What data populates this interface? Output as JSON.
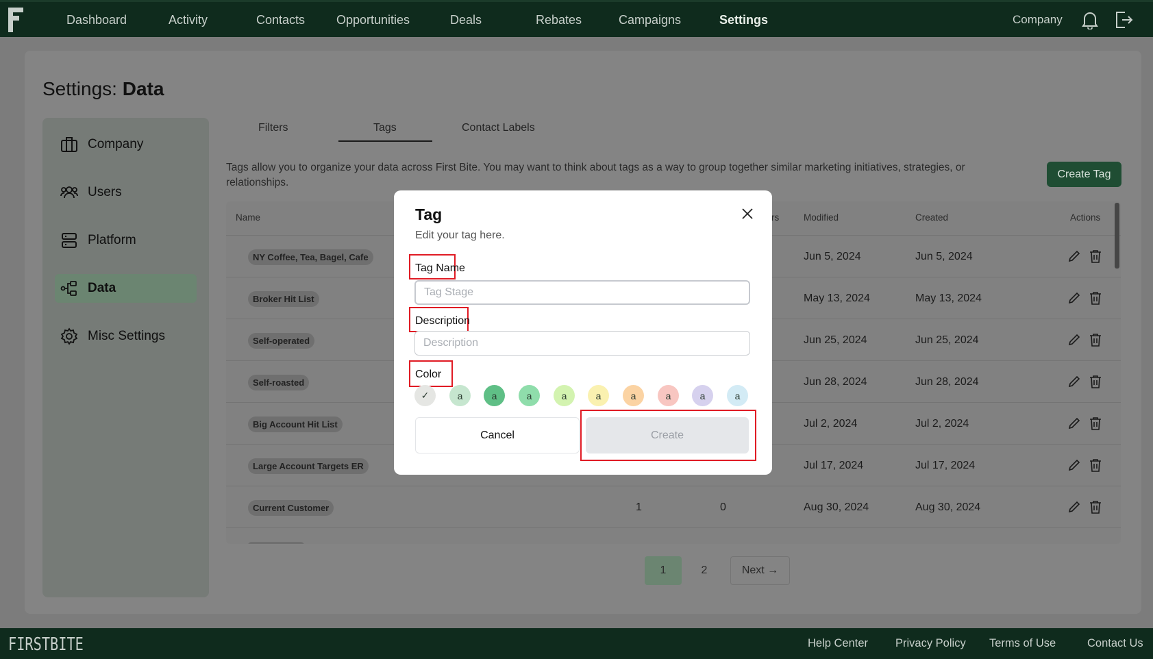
{
  "nav": {
    "items": [
      "Dashboard",
      "Activity",
      "Contacts",
      "Opportunities",
      "Deals",
      "Rebates",
      "Campaigns",
      "Settings"
    ],
    "active": "Settings",
    "company_label": "Company",
    "bell_icon": "bell-icon",
    "logout_icon": "logout-icon"
  },
  "page": {
    "title_prefix": "Settings: ",
    "title_bold": "Data"
  },
  "sidebar": {
    "items": [
      {
        "label": "Company",
        "icon": "briefcase-icon"
      },
      {
        "label": "Users",
        "icon": "users-icon"
      },
      {
        "label": "Platform",
        "icon": "server-icon"
      },
      {
        "label": "Data",
        "icon": "data-icon"
      },
      {
        "label": "Misc Settings",
        "icon": "gear-icon"
      }
    ],
    "active": "Data"
  },
  "tabs": {
    "items": [
      "Filters",
      "Tags",
      "Contact Labels"
    ],
    "active": "Tags"
  },
  "intro_text": "Tags allow you to organize your data across First Bite. You may want to think about tags as a way to group together similar marketing initiatives, strategies, or relationships.",
  "create_tag_label": "Create Tag",
  "table": {
    "headers": {
      "name": "Name",
      "users_partial": "rs",
      "modified": "Modified",
      "created": "Created",
      "actions": "Actions"
    },
    "rows": [
      {
        "name": "NY Coffee, Tea, Bagel, Cafe",
        "count1": "",
        "count2": "",
        "modified": "Jun 5, 2024",
        "created": "Jun 5, 2024"
      },
      {
        "name": "Broker Hit List",
        "count1": "",
        "count2": "",
        "modified": "May 13, 2024",
        "created": "May 13, 2024"
      },
      {
        "name": "Self-operated",
        "count1": "",
        "count2": "",
        "modified": "Jun 25, 2024",
        "created": "Jun 25, 2024"
      },
      {
        "name": "Self-roasted",
        "count1": "",
        "count2": "",
        "modified": "Jun 28, 2024",
        "created": "Jun 28, 2024"
      },
      {
        "name": "Big Account Hit List",
        "count1": "",
        "count2": "",
        "modified": "Jul 2, 2024",
        "created": "Jul 2, 2024"
      },
      {
        "name": "Large Account Targets ER",
        "count1": "",
        "count2": "",
        "modified": "Jul 17, 2024",
        "created": "Jul 17, 2024"
      },
      {
        "name": "Current Customer",
        "count1": "1",
        "count2": "0",
        "modified": "Aug 30, 2024",
        "created": "Aug 30, 2024"
      }
    ]
  },
  "pagination": {
    "pages": [
      "1",
      "2"
    ],
    "current": "1",
    "next_label": "Next →"
  },
  "footer": {
    "logo": "FIRSTBITE",
    "links": [
      "Help Center",
      "Privacy Policy",
      "Terms of Use",
      "Contact Us"
    ]
  },
  "modal": {
    "title": "Tag",
    "subtitle": "Edit your tag here.",
    "tag_name_label": "Tag Name",
    "tag_name_placeholder": "Tag Stage",
    "tag_name_value": "",
    "description_label": "Description",
    "description_placeholder": "Description",
    "color_label": "Color",
    "swatch_text": "a",
    "swatch_selected_mark": "✓",
    "swatch_colors": [
      "#e5e6e3",
      "#c6e6cf",
      "#5fbf86",
      "#8fddab",
      "#d3f3b0",
      "#faf1b0",
      "#fbd3a3",
      "#f8c6c1",
      "#d6d1ee",
      "#d3ebf5"
    ],
    "cancel_label": "Cancel",
    "create_label": "Create"
  }
}
